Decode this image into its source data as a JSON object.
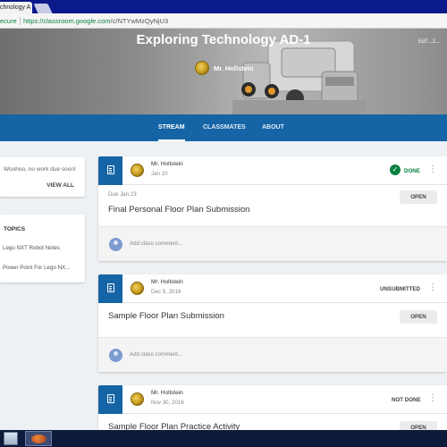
{
  "browser": {
    "tab_title": "chnology A",
    "secure_label": "ecure",
    "url_host": "https://classroom.google.com",
    "url_path": "/c/NTYwMzQyNjU3"
  },
  "header": {
    "course_title": "Exploring Technology AD-1",
    "teacher_name": "Mr. Hollstein",
    "corner_text": "Ed7...2..."
  },
  "nav": {
    "tabs": [
      {
        "label": "STREAM",
        "active": true
      },
      {
        "label": "CLASSMATES",
        "active": false
      },
      {
        "label": "ABOUT",
        "active": false
      }
    ]
  },
  "sidebar": {
    "upcoming_message": "Woohoo, no work due soon!",
    "view_all": "VIEW ALL",
    "topics_heading": "TOPICS",
    "topics": [
      "Lego NXT Robot Notes",
      "Power Point For Lego NX..."
    ]
  },
  "posts": [
    {
      "author": "Mr. Hollstein",
      "date": "Jan 10",
      "status": "DONE",
      "due": "Due Jan 23",
      "title": "Final Personal Floor Plan Submission",
      "open_label": "OPEN",
      "comment_placeholder": "Add class comment..."
    },
    {
      "author": "Mr. Hollstein",
      "date": "Dec 5, 2016",
      "status": "UNSUBMITTED",
      "due": "",
      "title": "Sample Floor Plan Submission",
      "open_label": "OPEN",
      "comment_placeholder": "Add class comment..."
    },
    {
      "author": "Mr. Hollstein",
      "date": "Nov 30, 2016",
      "status": "NOT DONE",
      "due": "",
      "title": "Sample Floor Plan Practice Activity",
      "open_label": "OPEN",
      "comment_placeholder": ""
    }
  ],
  "colors": {
    "nav_blue": "#1565a6",
    "done_green": "#0b8043",
    "background": "#eef1f4"
  }
}
